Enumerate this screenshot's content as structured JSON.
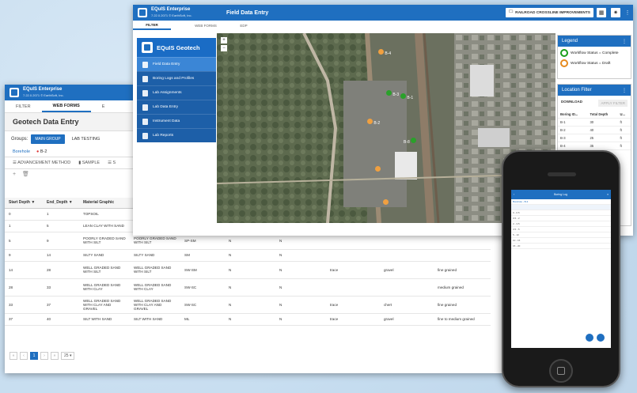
{
  "back": {
    "app_name": "EQuIS Enterprise",
    "app_version": "7.22.0.2071 © EarthSoft, Inc.",
    "tabs": [
      "FILTER",
      "WEB FORMS",
      "E"
    ],
    "title": "Geotech Data Entry",
    "groups_label": "Groups:",
    "group_main": "MAIN GROUP",
    "group_lab": "LAB TESTING",
    "borehole_label": "Borehole",
    "borehole_value": "B-2",
    "subtabs": [
      "ADVANCEMENT METHOD",
      "SAMPLE",
      "S"
    ],
    "columns": [
      "Start Depth",
      "End_Depth",
      "Material Graphic"
    ],
    "rows": [
      [
        "0",
        "1",
        "TOPSOIL",
        "",
        "",
        "",
        "",
        "",
        "",
        "",
        ""
      ],
      [
        "1",
        "5",
        "LEAN CLAY WITH SAND",
        "",
        "",
        "",
        "",
        "",
        "",
        "",
        ""
      ],
      [
        "5",
        "9",
        "POORLY GRADED SAND WITH SILT",
        "POORLY GRADED SAND WITH SILT",
        "SP-SM",
        "N",
        "N",
        "",
        "",
        "",
        ""
      ],
      [
        "9",
        "14",
        "SILTY SAND",
        "SILTY SAND",
        "SM",
        "N",
        "N",
        "",
        "",
        "",
        ""
      ],
      [
        "14",
        "28",
        "WELL GRADED SAND WITH SILT",
        "WELL GRADED SAND WITH SILT",
        "SW-SM",
        "N",
        "N",
        "trace",
        "gravel",
        "fine grained",
        ""
      ],
      [
        "28",
        "33",
        "WELL GRADED SAND WITH CLAY",
        "WELL GRADED SAND WITH CLAY",
        "SW-SC",
        "N",
        "N",
        "",
        "",
        "medium grained",
        ""
      ],
      [
        "33",
        "37",
        "WELL GRADED SAND WITH CLAY AND GRAVEL",
        "WELL GRADED SAND WITH CLAY AND GRAVEL",
        "SW-SC",
        "N",
        "N",
        "trace",
        "chert",
        "fine grained",
        ""
      ],
      [
        "37",
        "40",
        "SILT WITH SAND",
        "SILT WITH SAND",
        "ML",
        "N",
        "N",
        "trace",
        "gravel",
        "fine to medium grained",
        ""
      ]
    ],
    "pager_page": "1",
    "pager_size": "25 ▾"
  },
  "front": {
    "app_name": "EQuIS Enterprise",
    "app_version": "7.22.0.2071 © EarthSoft, Inc.",
    "title": "Field Data Entry",
    "project": "RAILROAD CROSSLINE IMPROVEMENTS",
    "tabs": [
      "FILTER",
      "WEB FORMS",
      "EDP"
    ],
    "side_title": "EQuIS Geotech",
    "side_items": [
      "Field Data Entry",
      "Boring Logs and Profiles",
      "Lab Assignments",
      "Lab Data Entry",
      "Instrument Data",
      "Lab Reports"
    ],
    "legend_title": "Legend",
    "legend_items": [
      "Workflow Status = Complete",
      "Workflow Status = Draft"
    ],
    "lf_title": "Location Filter",
    "lf_download": "DOWNLOAD",
    "lf_apply": "APPLY FILTER",
    "lf_cols": [
      "Boring ID...",
      "Total Depth",
      "U..."
    ],
    "lf_rows": [
      [
        "B-1",
        "30",
        "ft"
      ],
      [
        "B-2",
        "40",
        "ft"
      ],
      [
        "B-3",
        "25",
        "ft"
      ],
      [
        "B-4",
        "35",
        "ft"
      ]
    ],
    "markers": [
      "B-4",
      "B-3",
      "B-1",
      "B-2",
      "B-8"
    ]
  },
  "phone": {
    "bar_title": "Boring Log",
    "borehole": "Borehole - B-3",
    "rows": [
      "0 - 0.5",
      "0.5 - 2",
      "2 - 3.5",
      "3.5 - 5",
      "5 - 10",
      "10 - 15",
      "15 - 20"
    ]
  }
}
